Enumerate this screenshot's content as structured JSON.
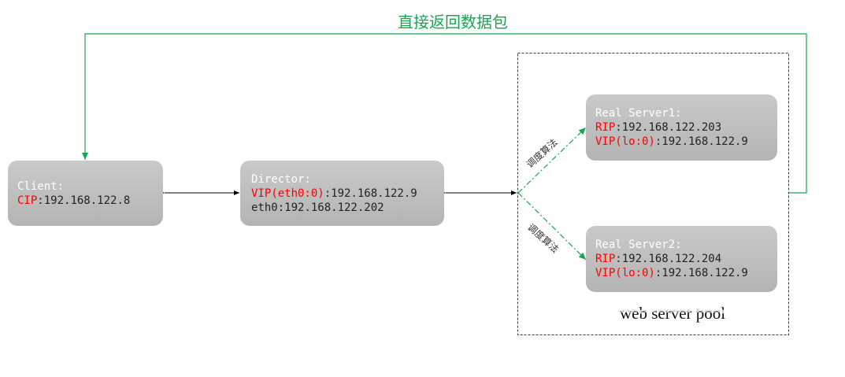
{
  "return_path_label": "直接返回数据包",
  "client": {
    "title": "Client:",
    "cip_key": "CIP",
    "cip_value": ":192.168.122.8"
  },
  "director": {
    "title": "Director:",
    "vip_key": "VIP(eth0:0)",
    "vip_value": ":192.168.122.9",
    "eth0": "eth0:192.168.122.202"
  },
  "real_server_1": {
    "title": "Real Server1:",
    "rip_key": "RIP",
    "rip_value": ":192.168.122.203",
    "vip_key": "VIP(lo:0)",
    "vip_value": ":192.168.122.9"
  },
  "real_server_2": {
    "title": "Real Server2:",
    "rip_key": "RIP",
    "rip_value": ":192.168.122.204",
    "vip_key": "VIP(lo:0)",
    "vip_value": ":192.168.122.9"
  },
  "scheduling_label_1": "调度算法",
  "scheduling_label_2": "调度算法",
  "pool_label": "web server pool",
  "colors": {
    "return_path": "#18a550",
    "pool_border": "#c00000",
    "key_text": "#ff0000",
    "node_fill": "#bdbdbd",
    "node_title": "#ffffff"
  }
}
